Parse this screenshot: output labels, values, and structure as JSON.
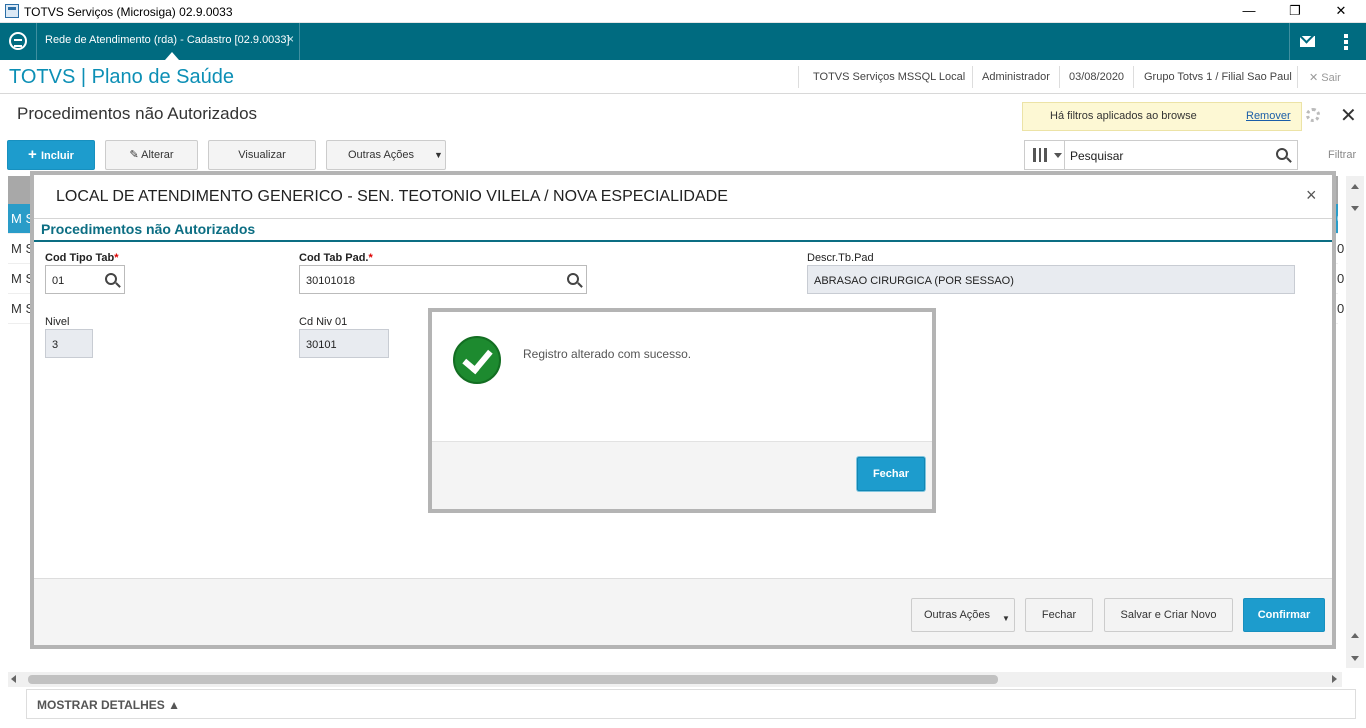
{
  "window": {
    "title": "TOTVS Serviços (Microsiga) 02.9.0033",
    "minimize": "—",
    "restore": "❐",
    "close": "✕"
  },
  "tabbar": {
    "tab_label": "Rede de Atendimento (rda) - Cadastro [02.9.0033]",
    "tab_close": "×",
    "accent": "#006b80"
  },
  "header": {
    "brand": "TOTVS | Plano de Saúde",
    "environment": "TOTVS Serviços MSSQL Local",
    "user": "Administrador",
    "date": "03/08/2020",
    "company": "Grupo Totvs 1 / Filial Sao Paul",
    "exit_icon": "✕",
    "exit_label": "Sair"
  },
  "browse": {
    "title": "Procedimentos não Autorizados",
    "filter_notice": "Há filtros aplicados ao browse",
    "filter_remove": "Remover",
    "close": "✕",
    "buttons": {
      "incluir": "Incluir",
      "alterar": "Alterar",
      "visualizar": "Visualizar",
      "outras_acoes": "Outras Ações"
    },
    "search_placeholder": "Pesquisar",
    "filter_label": "Filtrar",
    "rows": [
      {
        "left": "M S",
        "right": "0"
      },
      {
        "left": "M S",
        "right": "0"
      },
      {
        "left": "M S",
        "right": "0"
      },
      {
        "left": "M S",
        "right": "0"
      }
    ],
    "details_label": "MOSTRAR DETALHES ▲"
  },
  "modal": {
    "title": "LOCAL DE ATENDIMENTO GENERICO - SEN. TEOTONIO VILELA / NOVA ESPECIALIDADE",
    "close": "×",
    "section": "Procedimentos não Autorizados",
    "fields": {
      "cod_tipo_tab": {
        "label": "Cod Tipo Tab",
        "required": "*",
        "value": "01"
      },
      "cod_tab_pad": {
        "label": "Cod Tab Pad.",
        "required": "*",
        "value": "30101018"
      },
      "descr_tb_pad": {
        "label": "Descr.Tb.Pad",
        "value": "ABRASAO CIRURGICA (POR SESSAO)"
      },
      "nivel": {
        "label": "Nivel",
        "value": "3"
      },
      "cd_niv_01": {
        "label": "Cd Niv 01",
        "value": "30101"
      }
    },
    "footer": {
      "outras_acoes": "Outras Ações",
      "fechar": "Fechar",
      "salvar_criar_novo": "Salvar e Criar Novo",
      "confirmar": "Confirmar"
    }
  },
  "dialog": {
    "message": "Registro alterado com sucesso.",
    "button": "Fechar",
    "icon": "check-circle-icon",
    "icon_color": "#1d8a2f"
  }
}
